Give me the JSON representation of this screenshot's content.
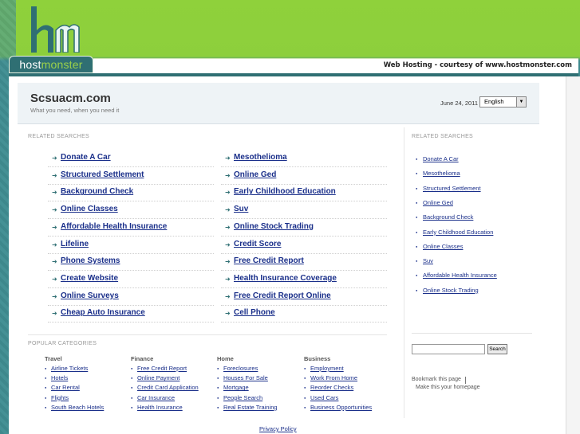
{
  "header": {
    "brand_host": "host",
    "brand_monster": "monster",
    "courtesy": "Web Hosting - courtesy of www.hostmonster.com"
  },
  "site": {
    "title": "Scsuacm.com",
    "tagline": "What you need, when you need it",
    "date": "June 24, 2011",
    "language": "English"
  },
  "related": {
    "heading": "RELATED SEARCHES",
    "left": [
      "Donate A Car",
      "Structured Settlement",
      "Background Check",
      "Online Classes",
      "Affordable Health Insurance",
      "Lifeline",
      "Phone Systems",
      "Create Website",
      "Online Surveys",
      "Cheap Auto Insurance"
    ],
    "right": [
      "Mesothelioma",
      "Online Ged",
      "Early Childhood Education",
      "Suv",
      "Online Stock Trading",
      "Credit Score",
      "Free Credit Report",
      "Health Insurance Coverage",
      "Free Credit Report Online",
      "Cell Phone"
    ]
  },
  "sidebar": {
    "heading": "RELATED SEARCHES",
    "items": [
      "Donate A Car",
      "Mesothelioma",
      "Structured Settlement",
      "Online Ged",
      "Background Check",
      "Early Childhood Education",
      "Online Classes",
      "Suv",
      "Affordable Health Insurance",
      "Online Stock Trading"
    ],
    "search_button": "Search",
    "bookmark": "Bookmark this page",
    "make_home": "Make this your homepage"
  },
  "popular": {
    "heading": "POPULAR CATEGORIES",
    "columns": [
      {
        "title": "Travel",
        "items": [
          "Airline Tickets",
          "Hotels",
          "Car Rental",
          "Flights",
          "South Beach Hotels"
        ]
      },
      {
        "title": "Finance",
        "items": [
          "Free Credit Report",
          "Online Payment",
          "Credit Card Application",
          "Car Insurance",
          "Health Insurance"
        ]
      },
      {
        "title": "Home",
        "items": [
          "Foreclosures",
          "Houses For Sale",
          "Mortgage",
          "People Search",
          "Real Estate Training"
        ]
      },
      {
        "title": "Business",
        "items": [
          "Employment",
          "Work From Home",
          "Reorder Checks",
          "Used Cars",
          "Business Opportunities"
        ]
      }
    ]
  },
  "footer": {
    "privacy": "Privacy Policy"
  }
}
